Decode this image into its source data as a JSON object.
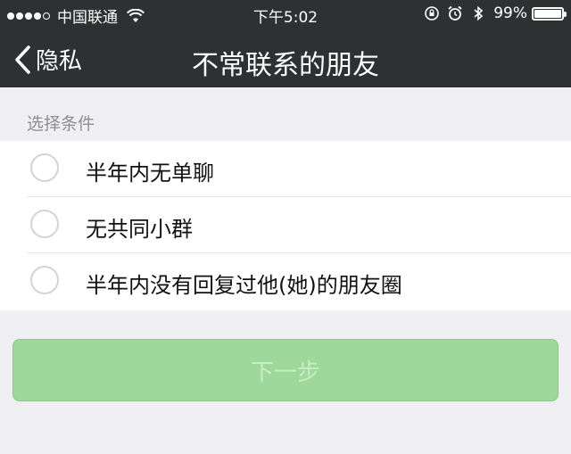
{
  "status_bar": {
    "carrier": "中国联通",
    "time": "下午5:02",
    "battery_percent": "99%",
    "battery_level": 0.99,
    "signal_bars_filled": 4,
    "signal_bars_total": 5
  },
  "nav": {
    "back_label": "隐私",
    "title": "不常联系的朋友"
  },
  "section": {
    "label": "选择条件"
  },
  "options": [
    {
      "label": "半年内无单聊",
      "selected": false
    },
    {
      "label": "无共同小群",
      "selected": false
    },
    {
      "label": "半年内没有回复过他(她)的朋友圈",
      "selected": false
    }
  ],
  "next_button": {
    "label": "下一步",
    "enabled": false
  },
  "colors": {
    "nav_background": "#2e3132",
    "page_background": "#efeff4",
    "button_disabled": "#9ed99b"
  }
}
